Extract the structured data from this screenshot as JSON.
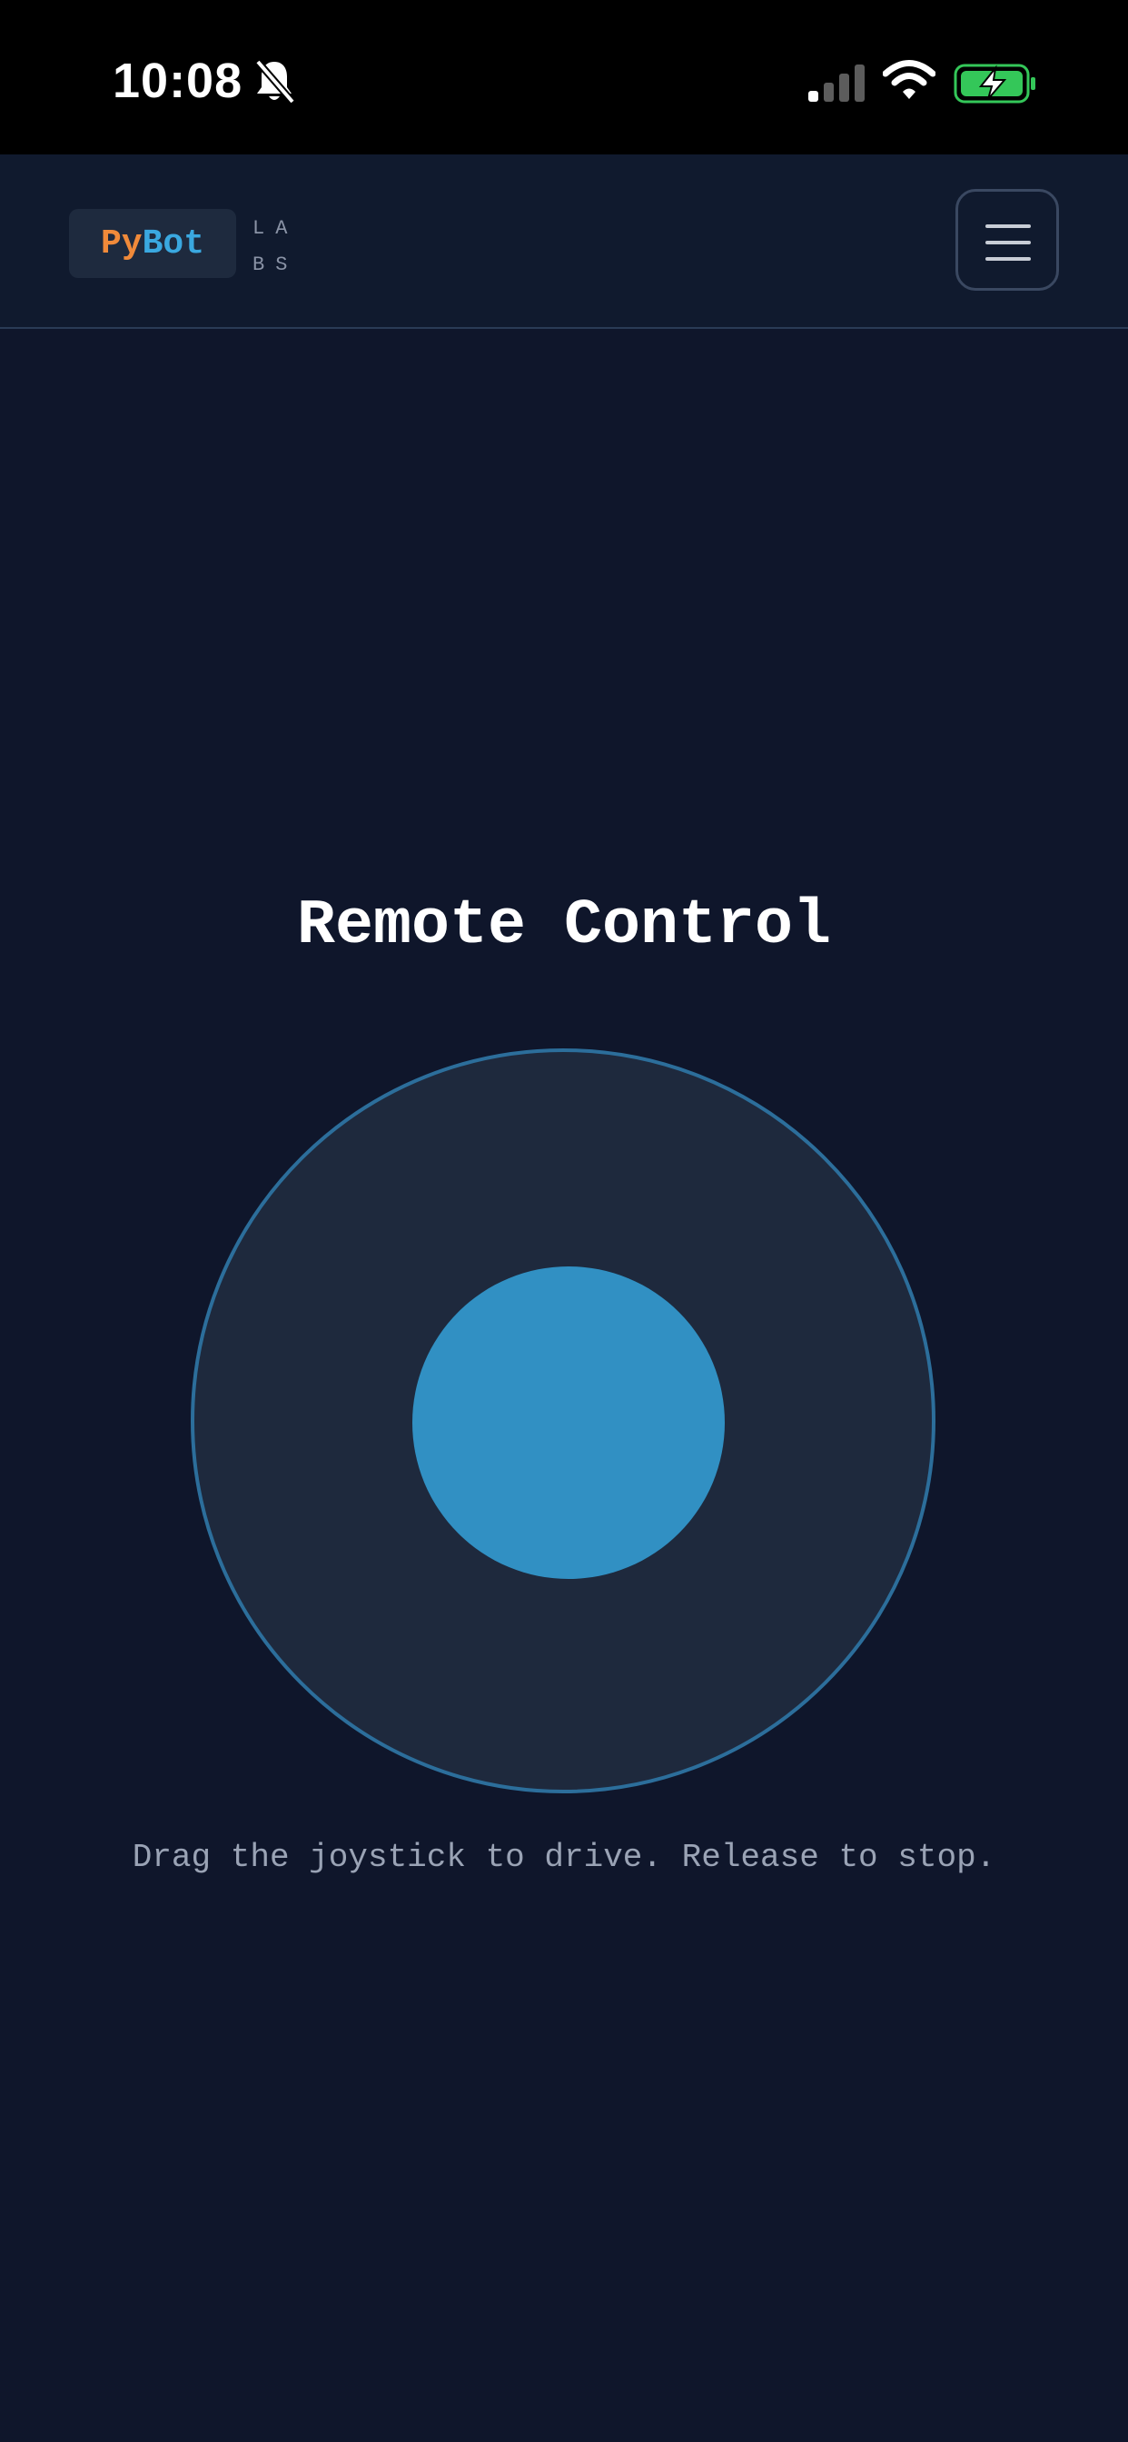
{
  "status_bar": {
    "time": "10:08",
    "icons": [
      "bell-slash-icon",
      "cellular-signal-icon",
      "wifi-icon",
      "battery-charging-icon"
    ]
  },
  "header": {
    "logo_part1": "Py",
    "logo_part2": "Bot",
    "logo_suffix": "LABS",
    "menu_icon": "hamburger-menu-icon"
  },
  "main": {
    "title": "Remote Control",
    "instruction": "Drag the joystick to drive. Release to stop."
  },
  "colors": {
    "background": "#0f162b",
    "header_background": "#101a2e",
    "logo_orange": "#f08a3a",
    "logo_blue": "#3aa8e0",
    "joystick_base": "#1e293d",
    "joystick_ring": "#2c6e9b",
    "joystick_knob": "#3190c3",
    "battery_green": "#34c759"
  }
}
